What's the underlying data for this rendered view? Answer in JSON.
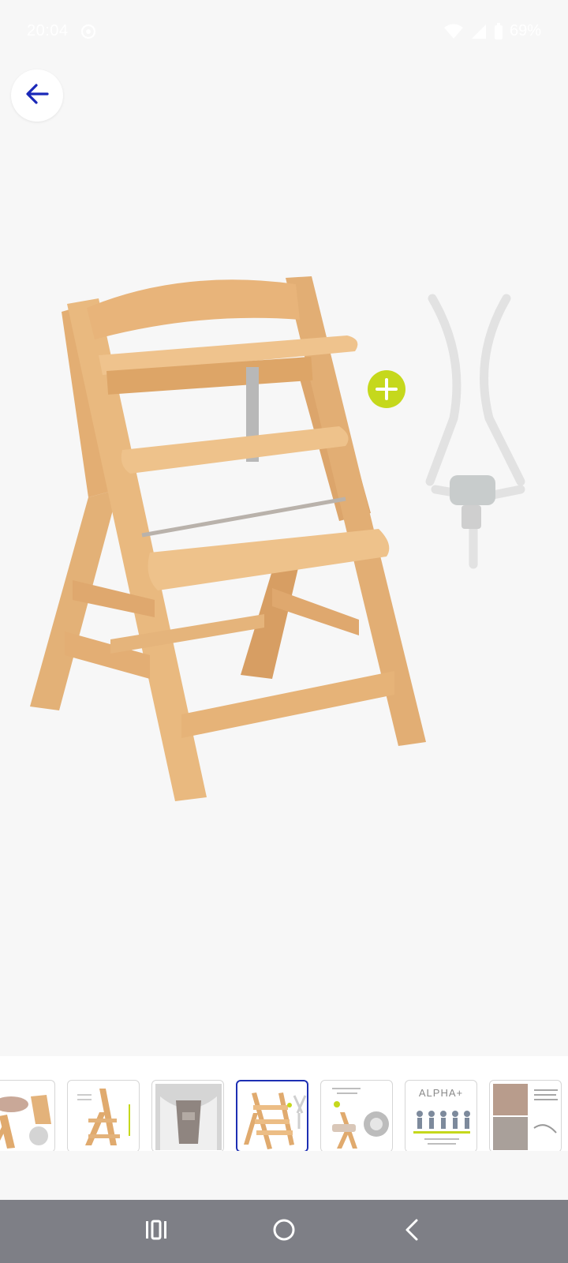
{
  "status_bar": {
    "time": "20:04",
    "battery": "69%",
    "icons": [
      "settings-gear-icon",
      "wifi-icon",
      "signal-icon",
      "battery-icon"
    ]
  },
  "header": {
    "back_icon": "arrow-left-icon",
    "accent_color": "#1a28b8"
  },
  "main_image": {
    "plus_badge_color": "#c5d81c",
    "wood_color": "#e3b177"
  },
  "thumbnails": {
    "items": [
      {
        "name": "thumbnail-1",
        "caption": ""
      },
      {
        "name": "thumbnail-2",
        "caption": ""
      },
      {
        "name": "thumbnail-3",
        "caption": ""
      },
      {
        "name": "thumbnail-4",
        "caption": ""
      },
      {
        "name": "thumbnail-5",
        "caption": ""
      },
      {
        "name": "thumbnail-6",
        "caption": "ALPHA+"
      },
      {
        "name": "thumbnail-7",
        "caption": ""
      }
    ],
    "selected_index": 3,
    "selected_color": "#1d2fb3"
  },
  "nav_bar": {
    "buttons": [
      "recent-apps-icon",
      "home-icon",
      "back-icon"
    ]
  }
}
